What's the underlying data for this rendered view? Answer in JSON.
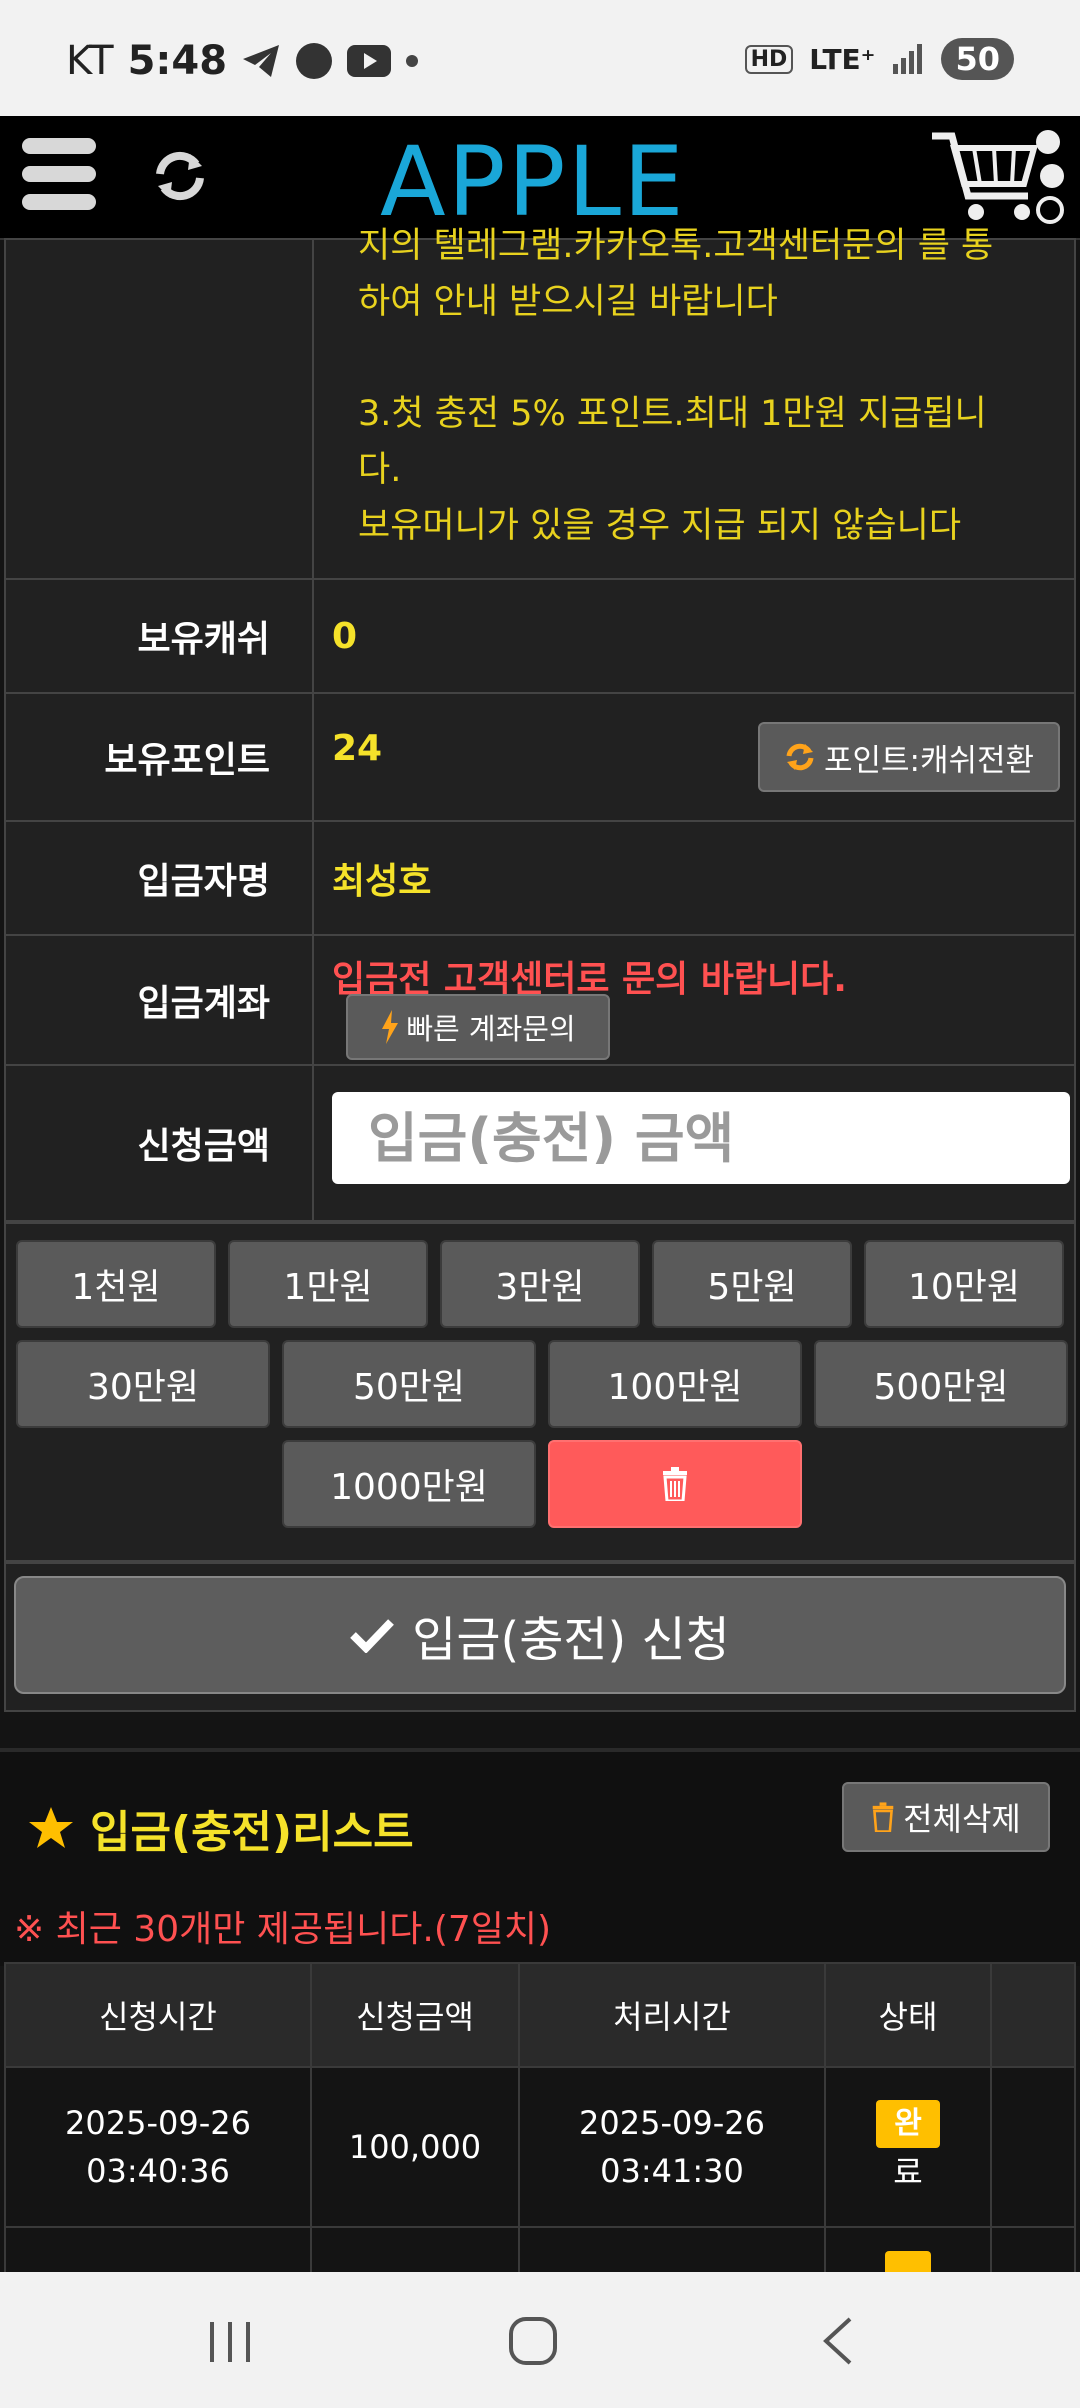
{
  "status_bar": {
    "carrier": "KT",
    "time": "5:48",
    "battery": "50",
    "network": "LTE⁺",
    "hd": "HD"
  },
  "header": {
    "logo": "APPLE"
  },
  "notice": {
    "line_partial": "지의 텔레그램.카카오톡.고객센터문의 를 통",
    "line_2": "하여 안내 받으시길 바랍니다",
    "line_3a": "3.첫 충전 5% 포인트.최대 1만원 지급됩니",
    "line_3b": "다.",
    "line_4": "보유머니가 있을 경우 지급 되지 않습니다"
  },
  "form": {
    "cash_label": "보유캐쉬",
    "cash_value": "0",
    "point_label": "보유포인트",
    "point_value": "24",
    "point_convert_label": "포인트:캐쉬전환",
    "depositor_label": "입금자명",
    "depositor_value": "최성호",
    "account_label": "입금계좌",
    "account_notice": "입금전 고객센터로 문의 바랍니다.",
    "account_inquiry_label": "빠른 계좌문의",
    "amount_label": "신청금액",
    "amount_placeholder": "입금(충전) 금액"
  },
  "quick_amounts": {
    "row1": [
      "1천원",
      "1만원",
      "3만원",
      "5만원",
      "10만원"
    ],
    "row2": [
      "30만원",
      "50만원",
      "100만원",
      "500만원"
    ],
    "row3": [
      "1000만원"
    ]
  },
  "submit_label": "입금(충전) 신청",
  "list": {
    "title": "입금(충전)리스트",
    "delete_all_label": "전체삭제",
    "note": "※ 최근 30개만 제공됩니다.(7일치)",
    "headers": [
      "신청시간",
      "신청금액",
      "처리시간",
      "상태"
    ],
    "rows": [
      {
        "req_date": "2025-09-26",
        "req_time": "03:40:36",
        "amount": "100,000",
        "proc_date": "2025-09-26",
        "proc_time": "03:41:30",
        "status_a": "완",
        "status_b": "료"
      }
    ]
  },
  "colors": {
    "accent_yellow": "#f5e22a",
    "logo_blue": "#1aa7d8",
    "red": "#ff5151",
    "badge": "#ffbf00"
  }
}
